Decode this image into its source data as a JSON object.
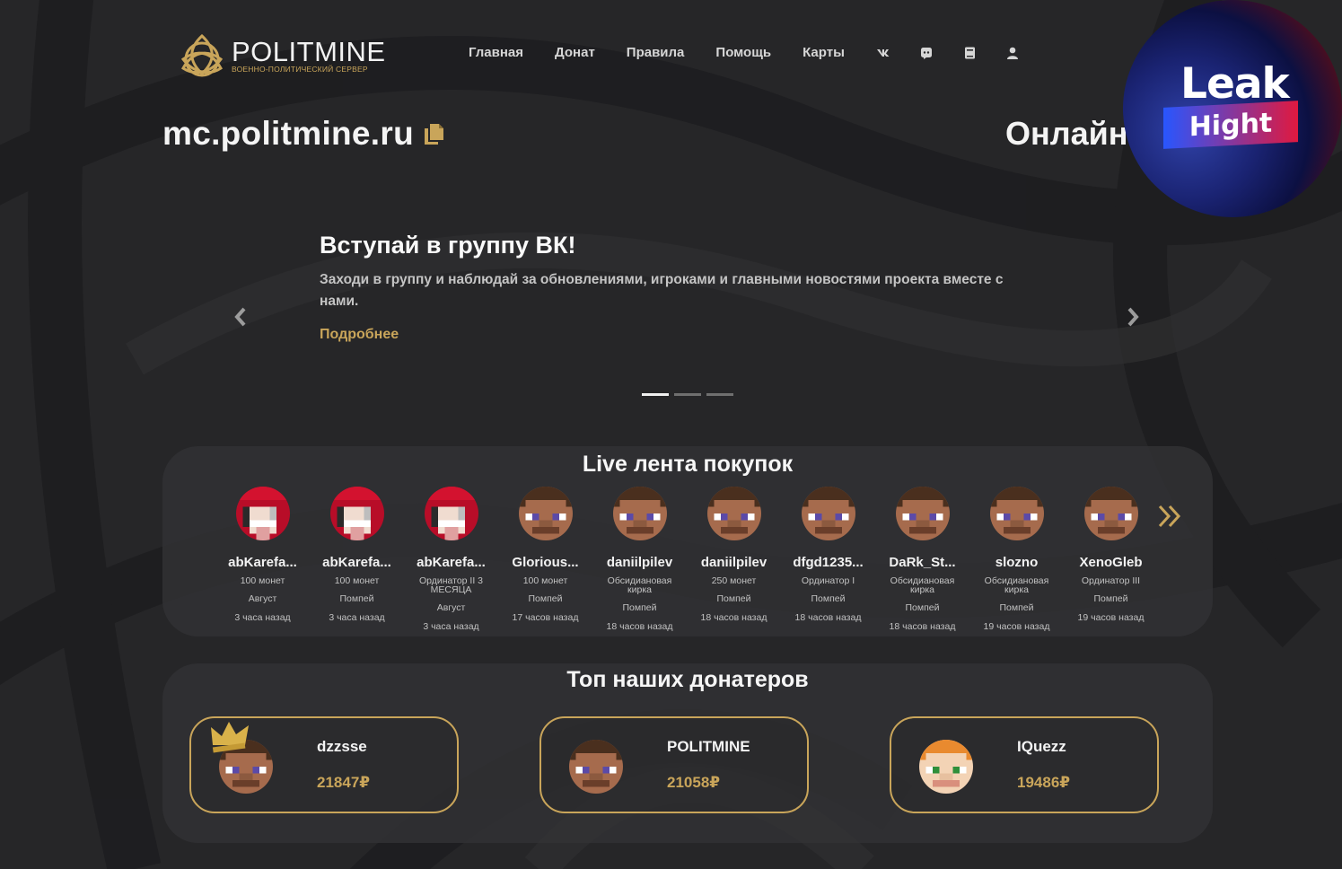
{
  "brand": {
    "name": "POLITMINE",
    "subtitle": "ВОЕННО-ПОЛИТИЧЕСКИЙ СЕРВЕР",
    "accent": "#c9a55a"
  },
  "nav": {
    "items": [
      "Главная",
      "Донат",
      "Правила",
      "Помощь",
      "Карты"
    ],
    "icons": [
      "vk-icon",
      "discord-icon",
      "book-icon",
      "user-icon"
    ]
  },
  "server": {
    "ip": "mc.politmine.ru",
    "online_label": "Онлайн"
  },
  "watermark": {
    "word1": "Leak",
    "word2": "Hight"
  },
  "slider": {
    "title": "Вступай в группу ВК!",
    "text": "Заходи в группу и наблюдай за обновлениями, игроками и главными новостями проекта вместе с нами.",
    "link": "Подробнее",
    "slides_count": 3,
    "active_index": 0
  },
  "feed": {
    "title": "Live лента покупок",
    "items": [
      {
        "name": "abKarefa...",
        "product": "100 монет",
        "server": "Август",
        "time": "3 часа назад",
        "skin": "red"
      },
      {
        "name": "abKarefa...",
        "product": "100 монет",
        "server": "Помпей",
        "time": "3 часа назад",
        "skin": "red"
      },
      {
        "name": "abKarefa...",
        "product": "Ординатор II 3 МЕСЯЦА",
        "server": "Август",
        "time": "3 часа назад",
        "skin": "red"
      },
      {
        "name": "Glorious...",
        "product": "100 монет",
        "server": "Помпей",
        "time": "17 часов назад",
        "skin": "steve"
      },
      {
        "name": "daniilpilev",
        "product": "Обсидиановая кирка",
        "server": "Помпей",
        "time": "18 часов назад",
        "skin": "steve"
      },
      {
        "name": "daniilpilev",
        "product": "250 монет",
        "server": "Помпей",
        "time": "18 часов назад",
        "skin": "steve"
      },
      {
        "name": "dfgd1235...",
        "product": "Ординатор I",
        "server": "Помпей",
        "time": "18 часов назад",
        "skin": "steve"
      },
      {
        "name": "DaRk_St...",
        "product": "Обсидиановая кирка",
        "server": "Помпей",
        "time": "18 часов назад",
        "skin": "steve"
      },
      {
        "name": "slozno",
        "product": "Обсидиановая кирка",
        "server": "Помпей",
        "time": "19 часов назад",
        "skin": "steve"
      },
      {
        "name": "XenoGleb",
        "product": "Ординатор III",
        "server": "Помпей",
        "time": "19 часов назад",
        "skin": "steve"
      }
    ]
  },
  "top": {
    "title": "Топ наших донатеров",
    "donors": [
      {
        "name": "dzzsse",
        "sum": "21847₽",
        "skin": "steve",
        "crown": true
      },
      {
        "name": "POLITMINE",
        "sum": "21058₽",
        "skin": "steve",
        "crown": false
      },
      {
        "name": "IQuezz",
        "sum": "19486₽",
        "skin": "alex",
        "crown": false
      }
    ]
  }
}
